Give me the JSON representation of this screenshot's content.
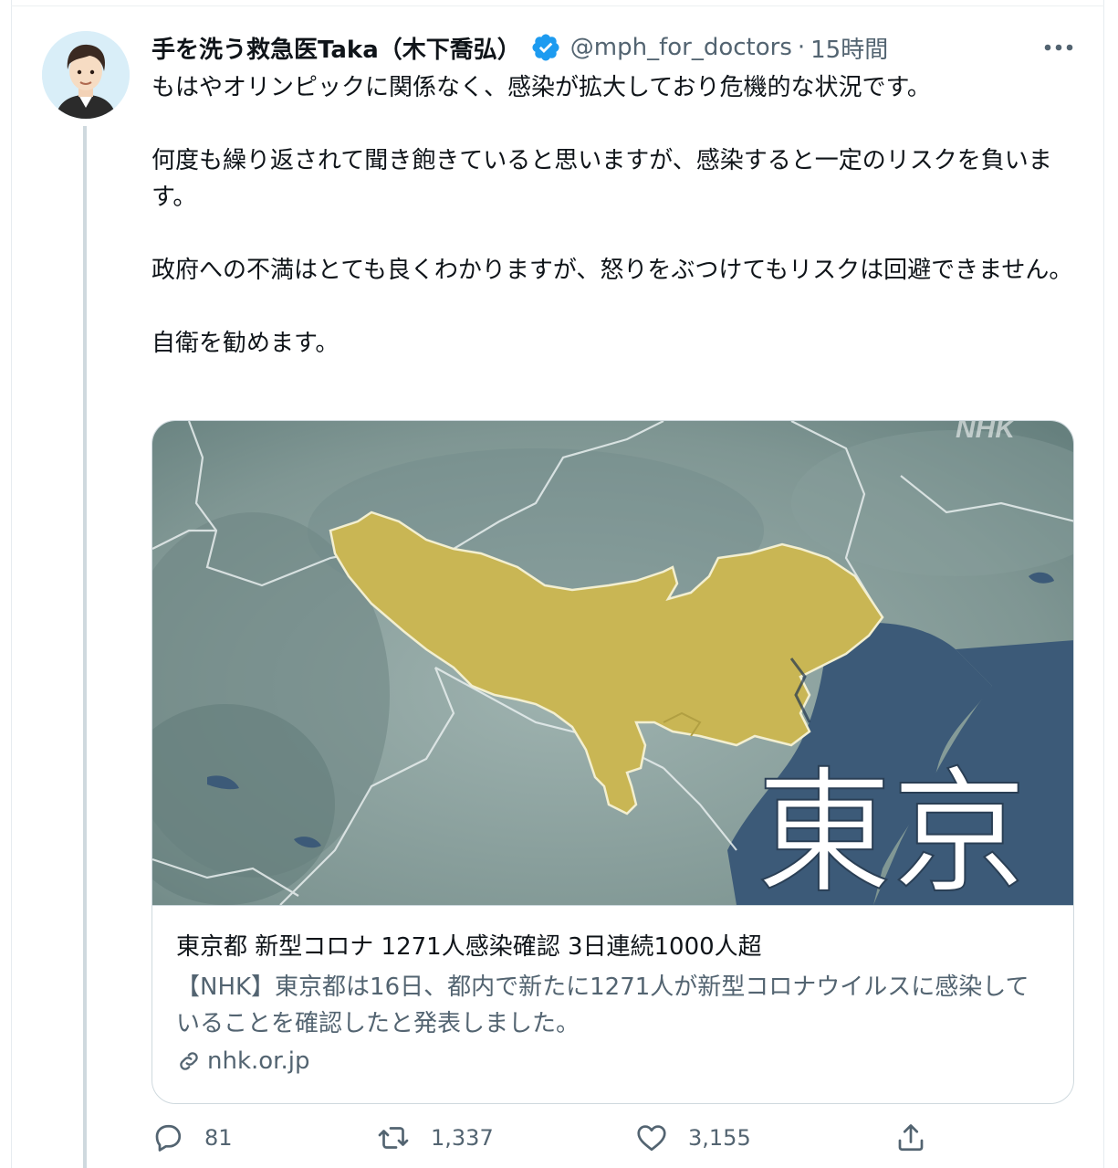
{
  "tweet": {
    "author_name": "手を洗う救急医Taka（木下喬弘）",
    "handle": "@mph_for_doctors",
    "separator": "·",
    "time": "15時間",
    "paragraphs": [
      "もはやオリンピックに関係なく、感染が拡大しており危機的な状況です。",
      "何度も繰り返されて聞き飽きていると思いますが、感染すると一定のリスクを負います。",
      "政府への不満はとても良くわかりますが、怒りをぶつけてもリスクは回避できません。",
      "自衛を勧めます。"
    ]
  },
  "card": {
    "image_watermark": "NHK",
    "image_caption": "東京",
    "title": "東京都 新型コロナ 1271人感染確認 3日連続1000人超",
    "description": "【NHK】東京都は16日、都内で新たに1271人が新型コロナウイルスに感染していることを確認したと発表しました。",
    "domain": "nhk.or.jp"
  },
  "actions": {
    "replies": "81",
    "retweets": "1,337",
    "likes": "3,155"
  },
  "icons": {
    "verified": "verified-badge-icon",
    "more": "more-icon",
    "link": "link-icon",
    "reply": "reply-icon",
    "retweet": "retweet-icon",
    "like": "heart-icon",
    "share": "share-icon"
  },
  "colors": {
    "accent": "#1d9bf0",
    "text": "#0f1419",
    "secondary": "#536471",
    "map_land": "#8fa5a3",
    "map_tokyo": "#c9b654",
    "map_water": "#3c5a78"
  }
}
